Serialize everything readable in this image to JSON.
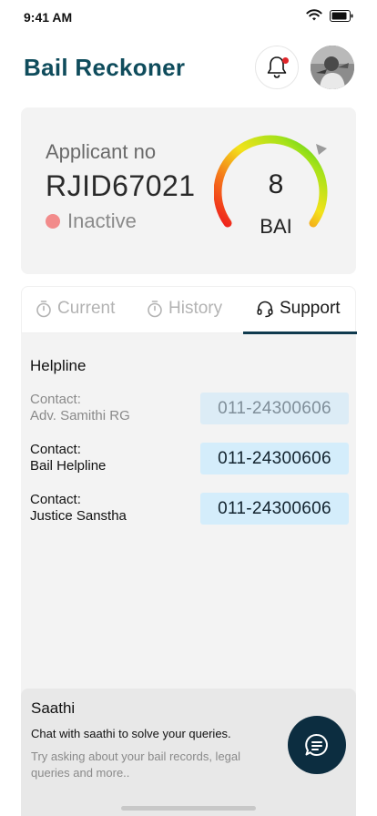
{
  "status_bar": {
    "time": "9:41 AM"
  },
  "header": {
    "title": "Bail Reckoner"
  },
  "applicant": {
    "label": "Applicant no",
    "id": "RJID67021",
    "status": "Inactive"
  },
  "gauge": {
    "value": "8",
    "label": "BAI"
  },
  "tabs": [
    {
      "label": "Current",
      "icon": "timer-icon"
    },
    {
      "label": "History",
      "icon": "timer-icon"
    },
    {
      "label": "Support",
      "icon": "headset-icon"
    }
  ],
  "active_tab": "Support",
  "support": {
    "heading": "Helpline",
    "contacts": [
      {
        "label": "Contact:",
        "name": "Adv. Samithi RG",
        "phone": "011-24300606"
      },
      {
        "label": "Contact:",
        "name": "Bail Helpline",
        "phone": "011-24300606"
      },
      {
        "label": "Contact:",
        "name": "Justice Sanstha",
        "phone": "011-24300606"
      }
    ]
  },
  "saathi": {
    "title": "Saathi",
    "subtitle": "Chat with saathi to solve your queries.",
    "hint": "Try asking about your bail records, legal queries and more.."
  },
  "colors": {
    "brand": "#0f4c5c",
    "accent_dark": "#0c2d40",
    "inactive_dot": "#f28b8b",
    "notification_dot": "#e0262b"
  }
}
